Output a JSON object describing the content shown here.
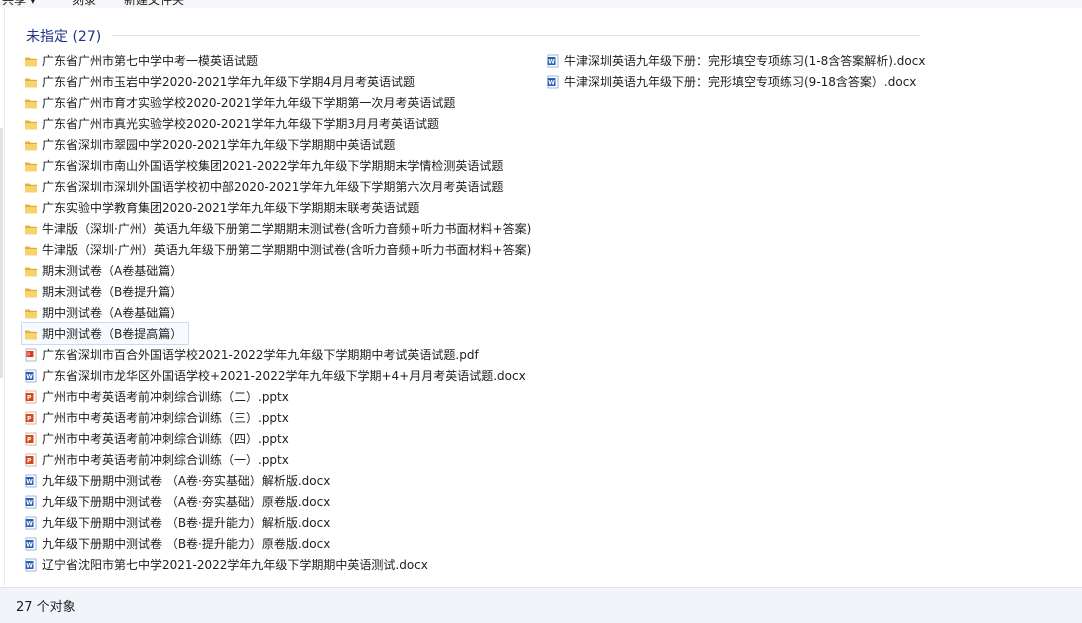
{
  "toolbar": {
    "share": "共享 ▾",
    "burn": "刻录",
    "new_folder": "新建文件夹"
  },
  "group": {
    "title": "未指定 (27)"
  },
  "files_col1": [
    {
      "name": "广东省广州市第七中学中考一模英语试题",
      "type": "folder"
    },
    {
      "name": "广东省广州市玉岩中学2020-2021学年九年级下学期4月月考英语试题",
      "type": "folder"
    },
    {
      "name": "广东省广州市育才实验学校2020-2021学年九年级下学期第一次月考英语试题",
      "type": "folder"
    },
    {
      "name": "广东省广州市真光实验学校2020-2021学年九年级下学期3月月考英语试题",
      "type": "folder"
    },
    {
      "name": "广东省深圳市翠园中学2020-2021学年九年级下学期期中英语试题",
      "type": "folder"
    },
    {
      "name": "广东省深圳市南山外国语学校集团2021-2022学年九年级下学期期末学情检测英语试题",
      "type": "folder"
    },
    {
      "name": "广东省深圳市深圳外国语学校初中部2020-2021学年九年级下学期第六次月考英语试题",
      "type": "folder"
    },
    {
      "name": "广东实验中学教育集团2020-2021学年九年级下学期期末联考英语试题",
      "type": "folder"
    },
    {
      "name": "牛津版（深圳·广州）英语九年级下册第二学期期末测试卷(含听力音频+听力书面材料+答案)",
      "type": "folder"
    },
    {
      "name": "牛津版（深圳·广州）英语九年级下册第二学期期中测试卷(含听力音频+听力书面材料+答案)",
      "type": "folder"
    },
    {
      "name": "期末测试卷（A卷基础篇）",
      "type": "folder"
    },
    {
      "name": "期末测试卷（B卷提升篇）",
      "type": "folder"
    },
    {
      "name": "期中测试卷（A卷基础篇）",
      "type": "folder"
    },
    {
      "name": "期中测试卷（B卷提高篇）",
      "type": "folder",
      "selected": true
    },
    {
      "name": "广东省深圳市百合外国语学校2021-2022学年九年级下学期期中考试英语试题.pdf",
      "type": "pdf"
    },
    {
      "name": "广东省深圳市龙华区外国语学校+2021-2022学年九年级下学期+4+月月考英语试题.docx",
      "type": "docx"
    },
    {
      "name": "广州市中考英语考前冲刺综合训练（二）.pptx",
      "type": "pptx"
    },
    {
      "name": "广州市中考英语考前冲刺综合训练（三）.pptx",
      "type": "pptx"
    },
    {
      "name": "广州市中考英语考前冲刺综合训练（四）.pptx",
      "type": "pptx"
    },
    {
      "name": "广州市中考英语考前冲刺综合训练（一）.pptx",
      "type": "pptx"
    },
    {
      "name": "九年级下册期中测试卷 （A卷·夯实基础）解析版.docx",
      "type": "docx"
    },
    {
      "name": "九年级下册期中测试卷 （A卷·夯实基础）原卷版.docx",
      "type": "docx"
    },
    {
      "name": "九年级下册期中测试卷 （B卷·提升能力）解析版.docx",
      "type": "docx"
    },
    {
      "name": "九年级下册期中测试卷 （B卷·提升能力）原卷版.docx",
      "type": "docx"
    },
    {
      "name": "辽宁省沈阳市第七中学2021-2022学年九年级下学期期中英语测试.docx",
      "type": "docx"
    }
  ],
  "files_col2": [
    {
      "name": "牛津深圳英语九年级下册：完形填空专项练习(1-8含答案解析).docx",
      "type": "docx"
    },
    {
      "name": "牛津深圳英语九年级下册：完形填空专项练习(9-18含答案）.docx",
      "type": "docx"
    }
  ],
  "status": {
    "count_text": "27 个对象"
  },
  "icons": {
    "folder": "folder-icon",
    "pdf": "pdf-file-icon",
    "docx": "word-file-icon",
    "pptx": "powerpoint-file-icon"
  }
}
